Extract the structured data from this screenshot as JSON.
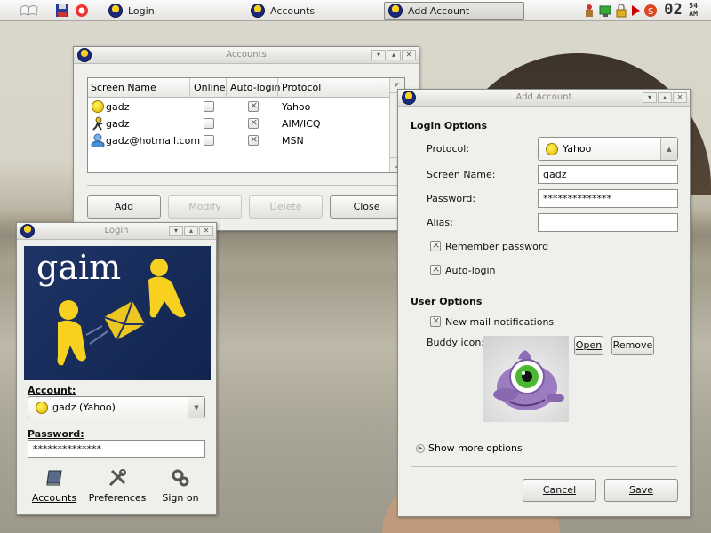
{
  "panel": {
    "login": "Login",
    "accounts": "Accounts",
    "add_account": "Add Account",
    "clock_h": "02",
    "clock_m": "54",
    "clock_ampm": "AM"
  },
  "accounts_window": {
    "title": "Accounts",
    "columns": [
      "Screen Name",
      "Online",
      "Auto-login",
      "Protocol"
    ],
    "rows": [
      {
        "screen_name": "gadz",
        "online": false,
        "auto_login": true,
        "protocol": "Yahoo",
        "icon": "yahoo-smiley-icon"
      },
      {
        "screen_name": "gadz",
        "online": false,
        "auto_login": true,
        "protocol": "AIM/ICQ",
        "icon": "aim-running-man-icon"
      },
      {
        "screen_name": "gadz@hotmail.com",
        "online": false,
        "auto_login": true,
        "protocol": "MSN",
        "icon": "msn-buddy-icon"
      }
    ],
    "buttons": {
      "add": "Add",
      "modify": "Modify",
      "delete": "Delete",
      "close": "Close"
    }
  },
  "login_window": {
    "title": "Login",
    "logo_text": "gaim",
    "account_label": "Account:",
    "account_value": "gadz (Yahoo)",
    "password_label": "Password:",
    "password_value": "**************",
    "actions": {
      "accounts": "Accounts",
      "preferences": "Preferences",
      "sign_on": "Sign on"
    }
  },
  "add_account_window": {
    "title": "Add Account",
    "login_options": "Login Options",
    "protocol_label": "Protocol:",
    "protocol_value": "Yahoo",
    "screen_name_label": "Screen Name:",
    "screen_name_value": "gadz",
    "password_label": "Password:",
    "password_value": "**************",
    "alias_label": "Alias:",
    "alias_value": "",
    "remember_password": "Remember password",
    "auto_login": "Auto-login",
    "user_options": "User Options",
    "new_mail": "New mail notifications",
    "buddy_icon_label": "Buddy icon:",
    "open": "Open",
    "remove": "Remove",
    "show_more": "Show more options",
    "cancel": "Cancel",
    "save": "Save"
  }
}
